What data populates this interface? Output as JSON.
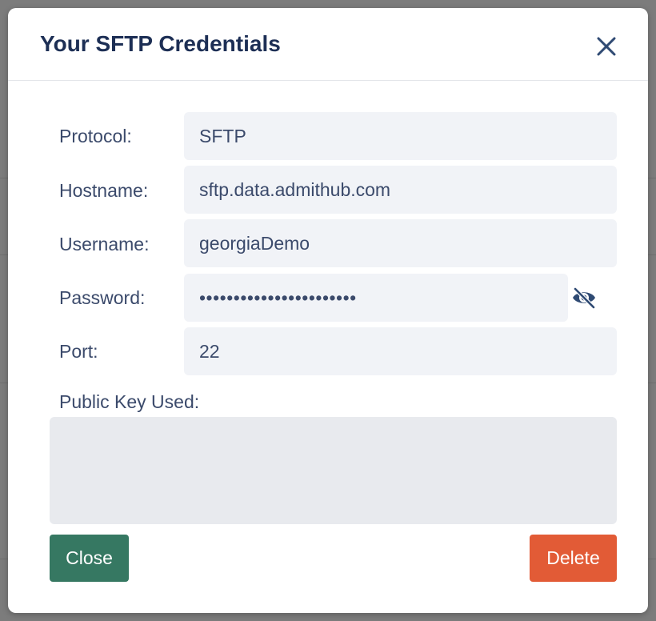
{
  "modal": {
    "title": "Your SFTP Credentials"
  },
  "fields": {
    "protocol": {
      "label": "Protocol:",
      "value": "SFTP"
    },
    "hostname": {
      "label": "Hostname:",
      "value": "sftp.data.admithub.com"
    },
    "username": {
      "label": "Username:",
      "value": "georgiaDemo"
    },
    "password": {
      "label": "Password:",
      "value": "•••••••••••••••••••••••"
    },
    "port": {
      "label": "Port:",
      "value": "22"
    }
  },
  "public_key": {
    "label": "Public Key Used:",
    "value": ""
  },
  "buttons": {
    "close_label": "Close",
    "delete_label": "Delete"
  },
  "icons": {
    "close": "close-icon",
    "password_toggle": "eye-slash-icon"
  },
  "colors": {
    "title": "#1d2f55",
    "close_button": "#367862",
    "delete_button": "#e25b36",
    "field_background": "#f1f3f7",
    "backdrop": "#7c7c7c"
  }
}
